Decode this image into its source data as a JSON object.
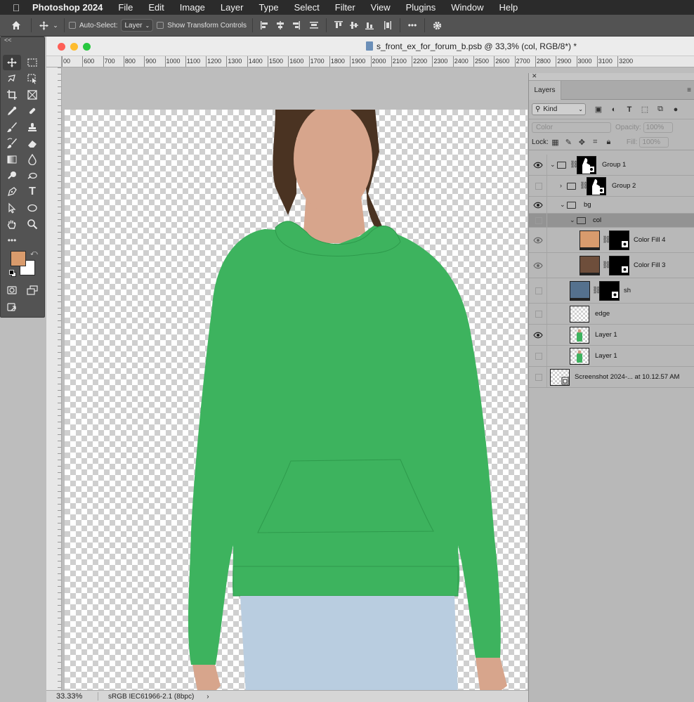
{
  "menubar": {
    "apple_icon": "apple-icon",
    "items": [
      "Photoshop 2024",
      "File",
      "Edit",
      "Image",
      "Layer",
      "Type",
      "Select",
      "Filter",
      "View",
      "Plugins",
      "Window",
      "Help"
    ]
  },
  "options_bar": {
    "home_icon": "home-icon",
    "move_icon": "move-tool-icon",
    "auto_select_label": "Auto-Select:",
    "auto_select_value": "Layer",
    "show_transform_label": "Show Transform Controls",
    "more_label": "•••",
    "settings_icon": "gear-icon"
  },
  "toolbar": {
    "collapse_label": "<<",
    "more_tools_label": "•••",
    "foreground_color": "#d99b6c",
    "background_color": "#ffffff"
  },
  "document": {
    "title": "s_front_ex_for_forum_b.psb @ 33,3% (col, RGB/8*) *",
    "ruler_labels": [
      "00",
      "600",
      "700",
      "800",
      "900",
      "1000",
      "1100",
      "1200",
      "1300",
      "1400",
      "1500",
      "1600",
      "1700",
      "1800",
      "1900",
      "2000",
      "2100",
      "2200",
      "2300",
      "2400",
      "2500",
      "2600",
      "2700",
      "2800",
      "2900",
      "3000",
      "3100",
      "3200"
    ],
    "zoom": "33.33%",
    "color_profile": "sRGB IEC61966-2.1 (8bpc)",
    "status_arrow": "›"
  },
  "layers_panel": {
    "tab_label": "Layers",
    "kind_label": "Kind",
    "blend_mode": "Color",
    "opacity_label": "Opacity:",
    "opacity_value": "100%",
    "lock_label": "Lock:",
    "fill_label": "Fill:",
    "fill_value": "100%",
    "layers": [
      {
        "name": "Group 1",
        "visible": true
      },
      {
        "name": "Group 2",
        "visible": false
      },
      {
        "name": "bg",
        "visible": true
      },
      {
        "name": "col",
        "visible": false,
        "selected": true
      },
      {
        "name": "Color Fill 4",
        "visible": true,
        "fill_color": "#d89b6d"
      },
      {
        "name": "Color Fill 3",
        "visible": true,
        "fill_color": "#6e4e3b"
      },
      {
        "name": "sh",
        "visible": false,
        "fill_color": "#55718e"
      },
      {
        "name": "edge",
        "visible": false
      },
      {
        "name": "Layer 1",
        "visible": true
      },
      {
        "name": "Layer 1",
        "visible": false
      },
      {
        "name": "Screenshot 2024-... at 10.12.57 AM",
        "visible": false
      }
    ]
  },
  "colors": {
    "hoodie": "#3db35e",
    "jeans": "#b9cde0",
    "skin": "#d7a58c",
    "hair": "#4a3322"
  }
}
